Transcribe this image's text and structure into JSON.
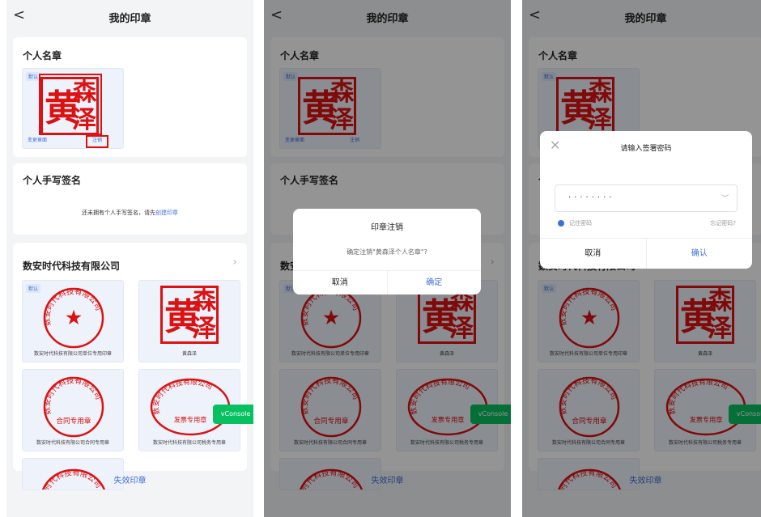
{
  "nav": {
    "title": "我的印章",
    "back_glyph": "<"
  },
  "personal_seal": {
    "title": "个人名章",
    "badge": "默认",
    "seal_chars": [
      "森",
      "黄",
      "泽"
    ],
    "change_label": "变更章面",
    "cancel_label": "注销"
  },
  "handwritten": {
    "title": "个人手写签名",
    "hint_prefix": "还未拥有个人手写签名，请先",
    "hint_link": "创建印章"
  },
  "company": {
    "name": "数安时代科技有限公司",
    "tiles": [
      {
        "badge": "默认",
        "caption": "数安时代科技有限公司单位专用印章",
        "kind": "round-star",
        "ring_text": "数安时代科技有限公司"
      },
      {
        "badge": "",
        "caption": "黄森泽",
        "kind": "square-name"
      },
      {
        "badge": "",
        "caption": "数安时代科技有限公司合同专用章",
        "kind": "round-contract",
        "ring_text": "数安时代科技有限公司",
        "inner_text": "合同专用章"
      },
      {
        "badge": "",
        "caption": "数安时代科技有限公司税务专用章",
        "kind": "oval-tax",
        "ring_text": "数安时代科技有限公司",
        "inner_text": "发票专用章"
      }
    ]
  },
  "footer_link": "失效印章",
  "vconsole": "vConsole",
  "cancel_dialog": {
    "title": "印章注销",
    "message": "确定注销\"黄森泽个人名章\"?",
    "cancel": "取消",
    "confirm": "确定"
  },
  "password_dialog": {
    "title": "请输入签署密码",
    "password_mask": "········",
    "remember": "记住密码",
    "forgot": "忘记密码?",
    "cancel": "取消",
    "confirm": "确认"
  },
  "colors": {
    "accent": "#3e6fd8",
    "seal_red": "#d11111",
    "vconsole_green": "#07c160"
  }
}
